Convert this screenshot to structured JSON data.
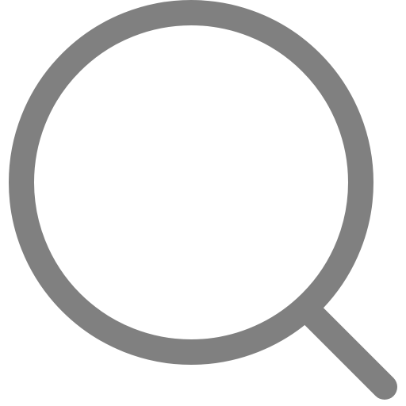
{
  "icon": {
    "name": "search-icon",
    "stroke_color": "#808080",
    "background": "#ffffff"
  }
}
